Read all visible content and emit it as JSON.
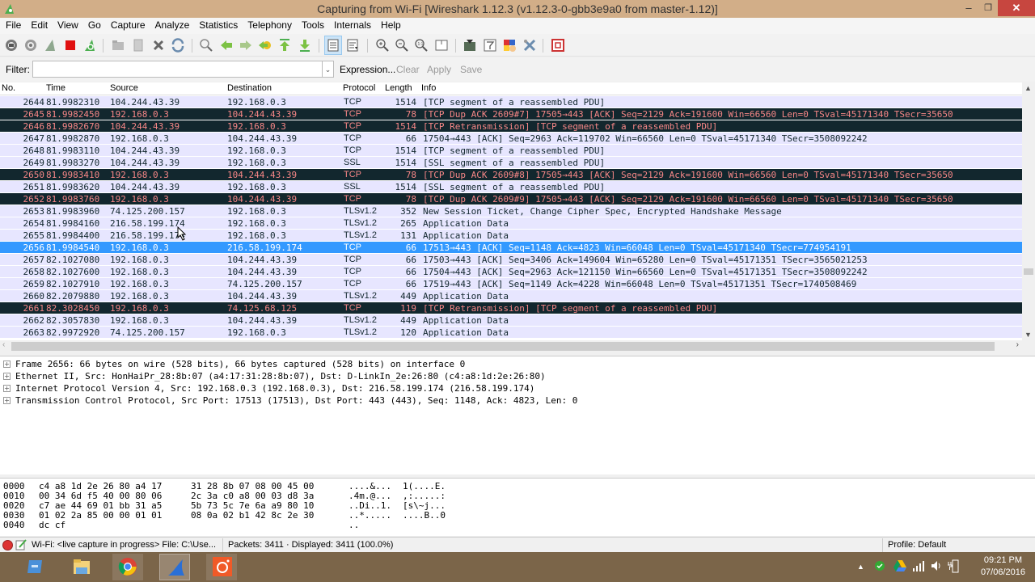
{
  "window": {
    "title": "Capturing from Wi-Fi   [Wireshark 1.12.3  (v1.12.3-0-gbb3e9a0 from master-1.12)]",
    "minimize": "–",
    "maximize": "❐",
    "close": "✕"
  },
  "menu": [
    "File",
    "Edit",
    "View",
    "Go",
    "Capture",
    "Analyze",
    "Statistics",
    "Telephony",
    "Tools",
    "Internals",
    "Help"
  ],
  "filter": {
    "label": "Filter:",
    "value": "",
    "placeholder": "",
    "dropdown": "⌄",
    "expression": "Expression...",
    "clear": "Clear",
    "apply": "Apply",
    "save": "Save"
  },
  "colors": {
    "normal_bg": "#e7e6ff",
    "bad_bg": "#12272e",
    "bad_fg": "#f78787",
    "selected_bg": "#3399ff"
  },
  "packet_list": {
    "columns": [
      "No.",
      "Time",
      "Source",
      "Destination",
      "Protocol",
      "Length",
      "Info"
    ],
    "rows": [
      {
        "no": "2644",
        "time": "81.9982310",
        "src": "104.244.43.39",
        "dst": "192.168.0.3",
        "proto": "TCP",
        "len": "1514",
        "info": "[TCP segment of a reassembled PDU]",
        "style": "normal"
      },
      {
        "no": "2645",
        "time": "81.9982450",
        "src": "192.168.0.3",
        "dst": "104.244.43.39",
        "proto": "TCP",
        "len": "78",
        "info": "[TCP Dup ACK 2609#7] 17505→443 [ACK] Seq=2129 Ack=191600 Win=66560 Len=0 TSval=45171340 TSecr=35650",
        "style": "bad"
      },
      {
        "no": "2646",
        "time": "81.9982670",
        "src": "104.244.43.39",
        "dst": "192.168.0.3",
        "proto": "TCP",
        "len": "1514",
        "info": "[TCP Retransmission] [TCP segment of a reassembled PDU]",
        "style": "bad"
      },
      {
        "no": "2647",
        "time": "81.9982870",
        "src": "192.168.0.3",
        "dst": "104.244.43.39",
        "proto": "TCP",
        "len": "66",
        "info": "17504→443 [ACK] Seq=2963 Ack=119702 Win=66560 Len=0 TSval=45171340 TSecr=3508092242",
        "style": "normal"
      },
      {
        "no": "2648",
        "time": "81.9983110",
        "src": "104.244.43.39",
        "dst": "192.168.0.3",
        "proto": "TCP",
        "len": "1514",
        "info": "[TCP segment of a reassembled PDU]",
        "style": "normal"
      },
      {
        "no": "2649",
        "time": "81.9983270",
        "src": "104.244.43.39",
        "dst": "192.168.0.3",
        "proto": "SSL",
        "len": "1514",
        "info": "[SSL segment of a reassembled PDU]",
        "style": "normal"
      },
      {
        "no": "2650",
        "time": "81.9983410",
        "src": "192.168.0.3",
        "dst": "104.244.43.39",
        "proto": "TCP",
        "len": "78",
        "info": "[TCP Dup ACK 2609#8] 17505→443 [ACK] Seq=2129 Ack=191600 Win=66560 Len=0 TSval=45171340 TSecr=35650",
        "style": "bad"
      },
      {
        "no": "2651",
        "time": "81.9983620",
        "src": "104.244.43.39",
        "dst": "192.168.0.3",
        "proto": "SSL",
        "len": "1514",
        "info": "[SSL segment of a reassembled PDU]",
        "style": "normal"
      },
      {
        "no": "2652",
        "time": "81.9983760",
        "src": "192.168.0.3",
        "dst": "104.244.43.39",
        "proto": "TCP",
        "len": "78",
        "info": "[TCP Dup ACK 2609#9] 17505→443 [ACK] Seq=2129 Ack=191600 Win=66560 Len=0 TSval=45171340 TSecr=35650",
        "style": "bad"
      },
      {
        "no": "2653",
        "time": "81.9983960",
        "src": "74.125.200.157",
        "dst": "192.168.0.3",
        "proto": "TLSv1.2",
        "len": "352",
        "info": "New Session Ticket, Change Cipher Spec, Encrypted Handshake Message",
        "style": "normal"
      },
      {
        "no": "2654",
        "time": "81.9984160",
        "src": "216.58.199.174",
        "dst": "192.168.0.3",
        "proto": "TLSv1.2",
        "len": "265",
        "info": "Application Data",
        "style": "normal"
      },
      {
        "no": "2655",
        "time": "81.9984400",
        "src": "216.58.199.174",
        "dst": "192.168.0.3",
        "proto": "TLSv1.2",
        "len": "131",
        "info": "Application Data",
        "style": "normal"
      },
      {
        "no": "2656",
        "time": "81.9984540",
        "src": "192.168.0.3",
        "dst": "216.58.199.174",
        "proto": "TCP",
        "len": "66",
        "info": "17513→443 [ACK] Seq=1148 Ack=4823 Win=66048 Len=0 TSval=45171340 TSecr=774954191",
        "style": "sel"
      },
      {
        "no": "2657",
        "time": "82.1027080",
        "src": "192.168.0.3",
        "dst": "104.244.43.39",
        "proto": "TCP",
        "len": "66",
        "info": "17503→443 [ACK] Seq=3406 Ack=149604 Win=65280 Len=0 TSval=45171351 TSecr=3565021253",
        "style": "normal"
      },
      {
        "no": "2658",
        "time": "82.1027600",
        "src": "192.168.0.3",
        "dst": "104.244.43.39",
        "proto": "TCP",
        "len": "66",
        "info": "17504→443 [ACK] Seq=2963 Ack=121150 Win=66560 Len=0 TSval=45171351 TSecr=3508092242",
        "style": "normal"
      },
      {
        "no": "2659",
        "time": "82.1027910",
        "src": "192.168.0.3",
        "dst": "74.125.200.157",
        "proto": "TCP",
        "len": "66",
        "info": "17519→443 [ACK] Seq=1149 Ack=4228 Win=66048 Len=0 TSval=45171351 TSecr=1740508469",
        "style": "normal"
      },
      {
        "no": "2660",
        "time": "82.2079880",
        "src": "192.168.0.3",
        "dst": "104.244.43.39",
        "proto": "TLSv1.2",
        "len": "449",
        "info": "Application Data",
        "style": "normal"
      },
      {
        "no": "2661",
        "time": "82.3028450",
        "src": "192.168.0.3",
        "dst": "74.125.68.125",
        "proto": "TCP",
        "len": "119",
        "info": "[TCP Retransmission] [TCP segment of a reassembled PDU]",
        "style": "bad"
      },
      {
        "no": "2662",
        "time": "82.3057830",
        "src": "192.168.0.3",
        "dst": "104.244.43.39",
        "proto": "TLSv1.2",
        "len": "449",
        "info": "Application Data",
        "style": "normal"
      },
      {
        "no": "2663",
        "time": "82.9972920",
        "src": "74.125.200.157",
        "dst": "192.168.0.3",
        "proto": "TLSv1.2",
        "len": "120",
        "info": "Application Data",
        "style": "normal"
      }
    ]
  },
  "details": [
    "Frame 2656: 66 bytes on wire (528 bits), 66 bytes captured (528 bits) on interface 0",
    "Ethernet II, Src: HonHaiPr_28:8b:07 (a4:17:31:28:8b:07), Dst: D-LinkIn_2e:26:80 (c4:a8:1d:2e:26:80)",
    "Internet Protocol Version 4, Src: 192.168.0.3 (192.168.0.3), Dst: 216.58.199.174 (216.58.199.174)",
    "Transmission Control Protocol, Src Port: 17513 (17513), Dst Port: 443 (443), Seq: 1148, Ack: 4823, Len: 0"
  ],
  "hex": [
    {
      "off": "0000",
      "b1": "c4 a8 1d 2e 26 80 a4 17",
      "b2": "31 28 8b 07 08 00 45 00",
      "a1": "....&...",
      "a2": "1(....E."
    },
    {
      "off": "0010",
      "b1": "00 34 6d f5 40 00 80 06",
      "b2": "2c 3a c0 a8 00 03 d8 3a",
      "a1": ".4m.@...",
      "a2": ",:.....:"
    },
    {
      "off": "0020",
      "b1": "c7 ae 44 69 01 bb 31 a5",
      "b2": "5b 73 5c 7e 6a a9 80 10",
      "a1": "..Di..1.",
      "a2": "[s\\~j..."
    },
    {
      "off": "0030",
      "b1": "01 02 2a 85 00 00 01 01",
      "b2": "08 0a 02 b1 42 8c 2e 30",
      "a1": "..*.....",
      "a2": "....B..0"
    },
    {
      "off": "0040",
      "b1": "dc cf",
      "b2": "",
      "a1": "..",
      "a2": ""
    }
  ],
  "status": {
    "capture": "Wi-Fi: <live capture in progress> File: C:\\Use...",
    "packets": "Packets: 3411 · Displayed: 3411 (100.0%)",
    "profile": "Profile: Default"
  },
  "taskbar": {
    "apps": [
      "file-explorer-desktop",
      "file-explorer",
      "chrome",
      "wireshark",
      "screen-recorder"
    ],
    "time": "09:21 PM",
    "date": "07/06/2016"
  }
}
